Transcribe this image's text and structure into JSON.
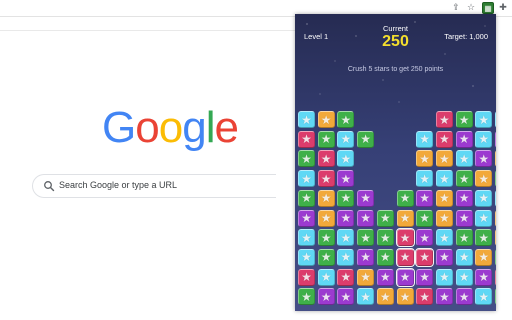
{
  "toolbar": {
    "icons": [
      "share-icon",
      "bookmark-star-icon",
      "extension-game-icon",
      "puzzle-extensions-icon"
    ]
  },
  "google": {
    "logo_letters": [
      {
        "ch": "G",
        "color": "#4285F4"
      },
      {
        "ch": "o",
        "color": "#EA4335"
      },
      {
        "ch": "o",
        "color": "#FBBC05"
      },
      {
        "ch": "g",
        "color": "#4285F4"
      },
      {
        "ch": "l",
        "color": "#34A853"
      },
      {
        "ch": "e",
        "color": "#EA4335"
      }
    ],
    "search_placeholder": "Search Google or type a URL"
  },
  "game": {
    "level": "Level 1",
    "current_label": "Current",
    "score": "250",
    "target": "Target: 1,000",
    "message": "Crush 5 stars to get 250 points",
    "colors": {
      "B": "#5fd8f5",
      "O": "#f2a93a",
      "R": "#dc3c6c",
      "G": "#3fb049",
      "P": "#9c3ad0"
    },
    "board_rows": [
      "BOG....RGBBG",
      "RGBG..BRPBPR",
      "GRB...OOBPOB",
      "BRP...BBGOGG",
      "GOGP.GPOPBBP",
      "POPPGOGOPBOP",
      "BGBGGRPBGGOP",
      "BGBPGRRPBOGO",
      "RBROPPPBBPRG",
      "GPPBOORPPBGG"
    ],
    "selected_cells": [
      [
        6,
        5
      ],
      [
        7,
        5
      ],
      [
        7,
        6
      ],
      [
        8,
        5
      ]
    ]
  }
}
